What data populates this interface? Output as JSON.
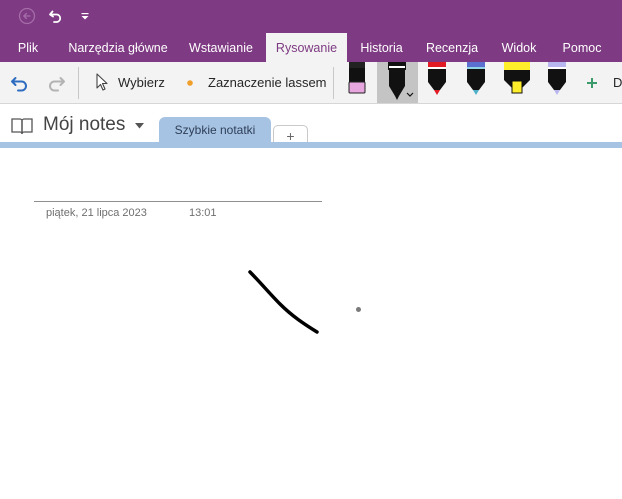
{
  "app": {
    "accent_color": "#7e3a82",
    "section_color": "#a6c3e3"
  },
  "quick_access": {
    "back_icon": "back-circle-icon",
    "undo_icon": "undo-icon",
    "customize_icon": "customize-qat-icon"
  },
  "ribbon": {
    "tabs": [
      {
        "label": "Plik",
        "active": false
      },
      {
        "label": "Narzędzia główne",
        "active": false
      },
      {
        "label": "Wstawianie",
        "active": false
      },
      {
        "label": "Rysowanie",
        "active": true
      },
      {
        "label": "Historia",
        "active": false
      },
      {
        "label": "Recenzja",
        "active": false
      },
      {
        "label": "Widok",
        "active": false
      },
      {
        "label": "Pomoc",
        "active": false
      }
    ]
  },
  "toolbar": {
    "select_label": "Wybierz",
    "lasso_label": "Zaznaczenie lassem",
    "add_pen_label": "D",
    "pens": [
      {
        "name": "pink-pen",
        "color": "#e7a6dd",
        "selected": false
      },
      {
        "name": "black-pen",
        "color": "#111111",
        "selected": true
      },
      {
        "name": "red-pen",
        "color": "#e01b24",
        "selected": false
      },
      {
        "name": "galaxy-pen",
        "color": "#5a6fd0",
        "selected": false
      },
      {
        "name": "yellow-highlighter",
        "color": "#ffee2a",
        "selected": false
      },
      {
        "name": "lavender-pen",
        "color": "#b8b6ee",
        "selected": false
      }
    ]
  },
  "notebook": {
    "name": "Mój notes",
    "section_tab": "Szybkie notatki",
    "add_section": "+"
  },
  "page": {
    "date": "piątek, 21 lipca 2023",
    "time": "13:01"
  }
}
